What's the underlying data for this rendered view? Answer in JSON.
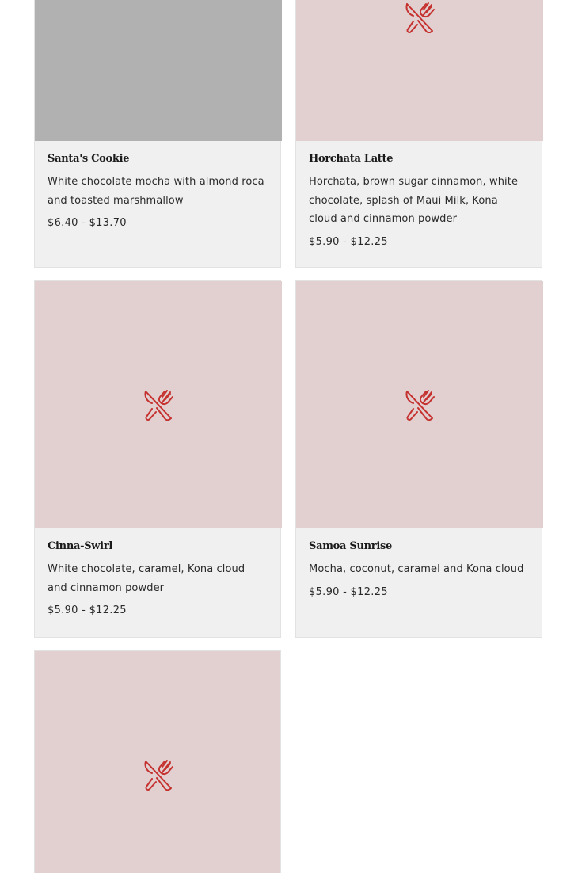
{
  "colors": {
    "image_placeholder": "#e2d0d1",
    "image_loading": "#b1b1b1",
    "card_background": "#f0f0f0",
    "icon": "#c5312f"
  },
  "placeholder_icon": "utensils-icon",
  "menu_items": [
    {
      "name": "Santa's Cookie",
      "description": "White chocolate mocha with almond roca and toasted marshmallow",
      "price": "$6.40 - $13.70"
    },
    {
      "name": "Horchata Latte",
      "description": "Horchata, brown sugar cinnamon, white chocolate, splash of Maui Milk, Kona cloud and cinnamon powder",
      "price": "$5.90 - $12.25"
    },
    {
      "name": "Cinna-Swirl",
      "description": "White chocolate, caramel, Kona cloud and cinnamon powder",
      "price": "$5.90 - $12.25"
    },
    {
      "name": "Samoa Sunrise",
      "description": "Mocha, coconut, caramel and Kona cloud",
      "price": "$5.90 - $12.25"
    }
  ]
}
